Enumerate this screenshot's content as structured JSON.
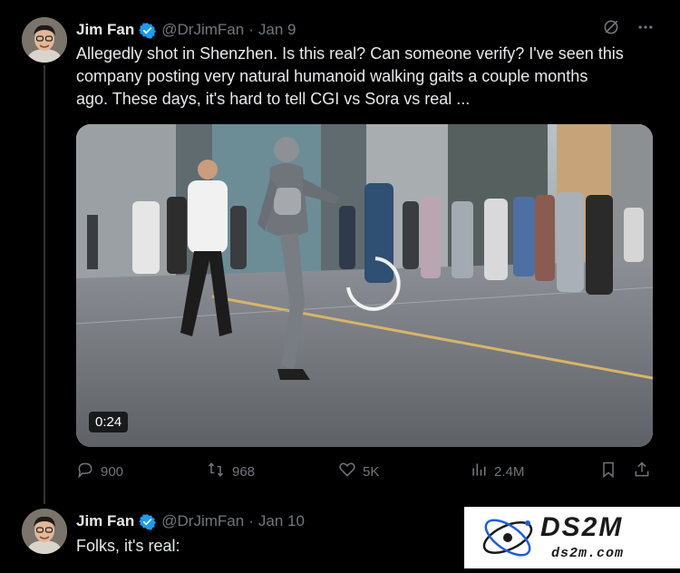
{
  "tweet1": {
    "name": "Jim Fan",
    "handle": "@DrJimFan",
    "separator": "·",
    "date": "Jan 9",
    "text_lines": [
      "Allegedly shot in Shenzhen. Is this real? Can someone verify? I've seen this",
      "company posting very natural humanoid walking gaits a couple months",
      "ago. These days, it's hard to tell CGI vs Sora vs real ..."
    ],
    "video_time": "0:24",
    "replies": "900",
    "reposts": "968",
    "likes": "5K",
    "views": "2.4M"
  },
  "tweet2": {
    "name": "Jim Fan",
    "handle": "@DrJimFan",
    "separator": "·",
    "date": "Jan 10",
    "text": "Folks, it's real:"
  },
  "watermark": {
    "brand": "DS2M",
    "url": "ds2m.com"
  },
  "colors": {
    "background": "#000000",
    "text": "#e7e9ea",
    "muted": "#71767b",
    "verified": "#1d9bf0",
    "watermark_ink": "#1a1a1a",
    "watermark_accent": "#1e5fd6"
  },
  "icons": [
    "grok-icon",
    "more-icon",
    "reply-icon",
    "repost-icon",
    "like-icon",
    "views-icon",
    "bookmark-icon",
    "share-icon",
    "verified-icon"
  ]
}
